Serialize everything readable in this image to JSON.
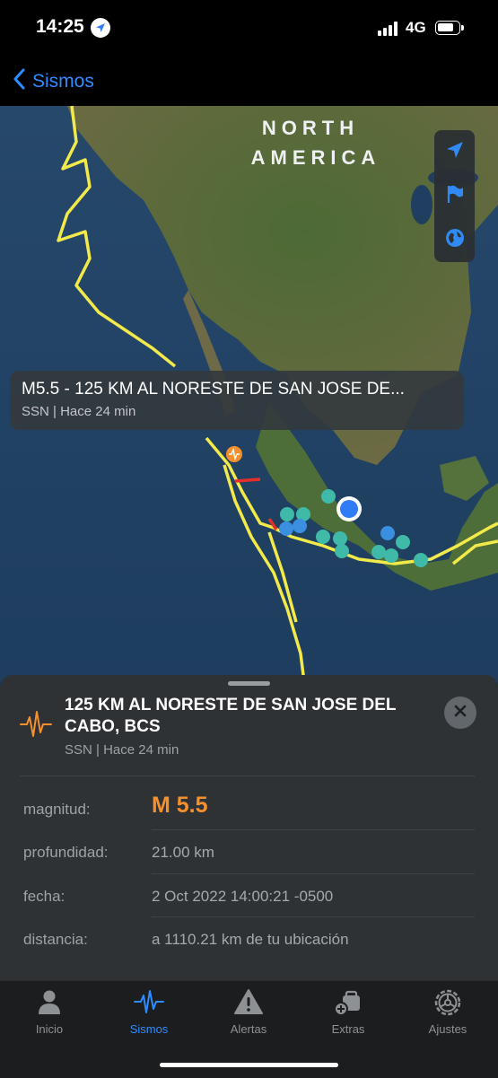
{
  "status": {
    "time": "14:25",
    "network": "4G"
  },
  "nav": {
    "back_label": "Sismos"
  },
  "map": {
    "region_label_line1": "NORTH",
    "region_label_line2": "AMERICA",
    "callout_title": "M5.5 - 125 KM AL NORESTE DE SAN JOSE DE...",
    "callout_subtitle": "SSN | Hace 24 min"
  },
  "detail": {
    "title": "125 KM AL NORESTE DE SAN JOSE DEL CABO, BCS",
    "subtitle": "SSN | Hace 24 min",
    "rows": [
      {
        "label": "magnitud:",
        "value": "M 5.5"
      },
      {
        "label": "profundidad:",
        "value": "21.00 km"
      },
      {
        "label": "fecha:",
        "value": "2 Oct 2022 14:00:21 -0500"
      },
      {
        "label": "distancia:",
        "value": "a 1110.21 km de tu ubicación"
      }
    ]
  },
  "tabs": [
    {
      "label": "Inicio",
      "icon": "person-icon"
    },
    {
      "label": "Sismos",
      "icon": "seismograph-icon"
    },
    {
      "label": "Alertas",
      "icon": "warning-icon"
    },
    {
      "label": "Extras",
      "icon": "extras-icon"
    },
    {
      "label": "Ajustes",
      "icon": "gear-icon"
    }
  ],
  "active_tab": "Sismos",
  "colors": {
    "accent": "#2f8cff",
    "magnitude": "#f5902c",
    "fault_line": "#f2e94a",
    "event_marker": "#3fb9a8"
  }
}
